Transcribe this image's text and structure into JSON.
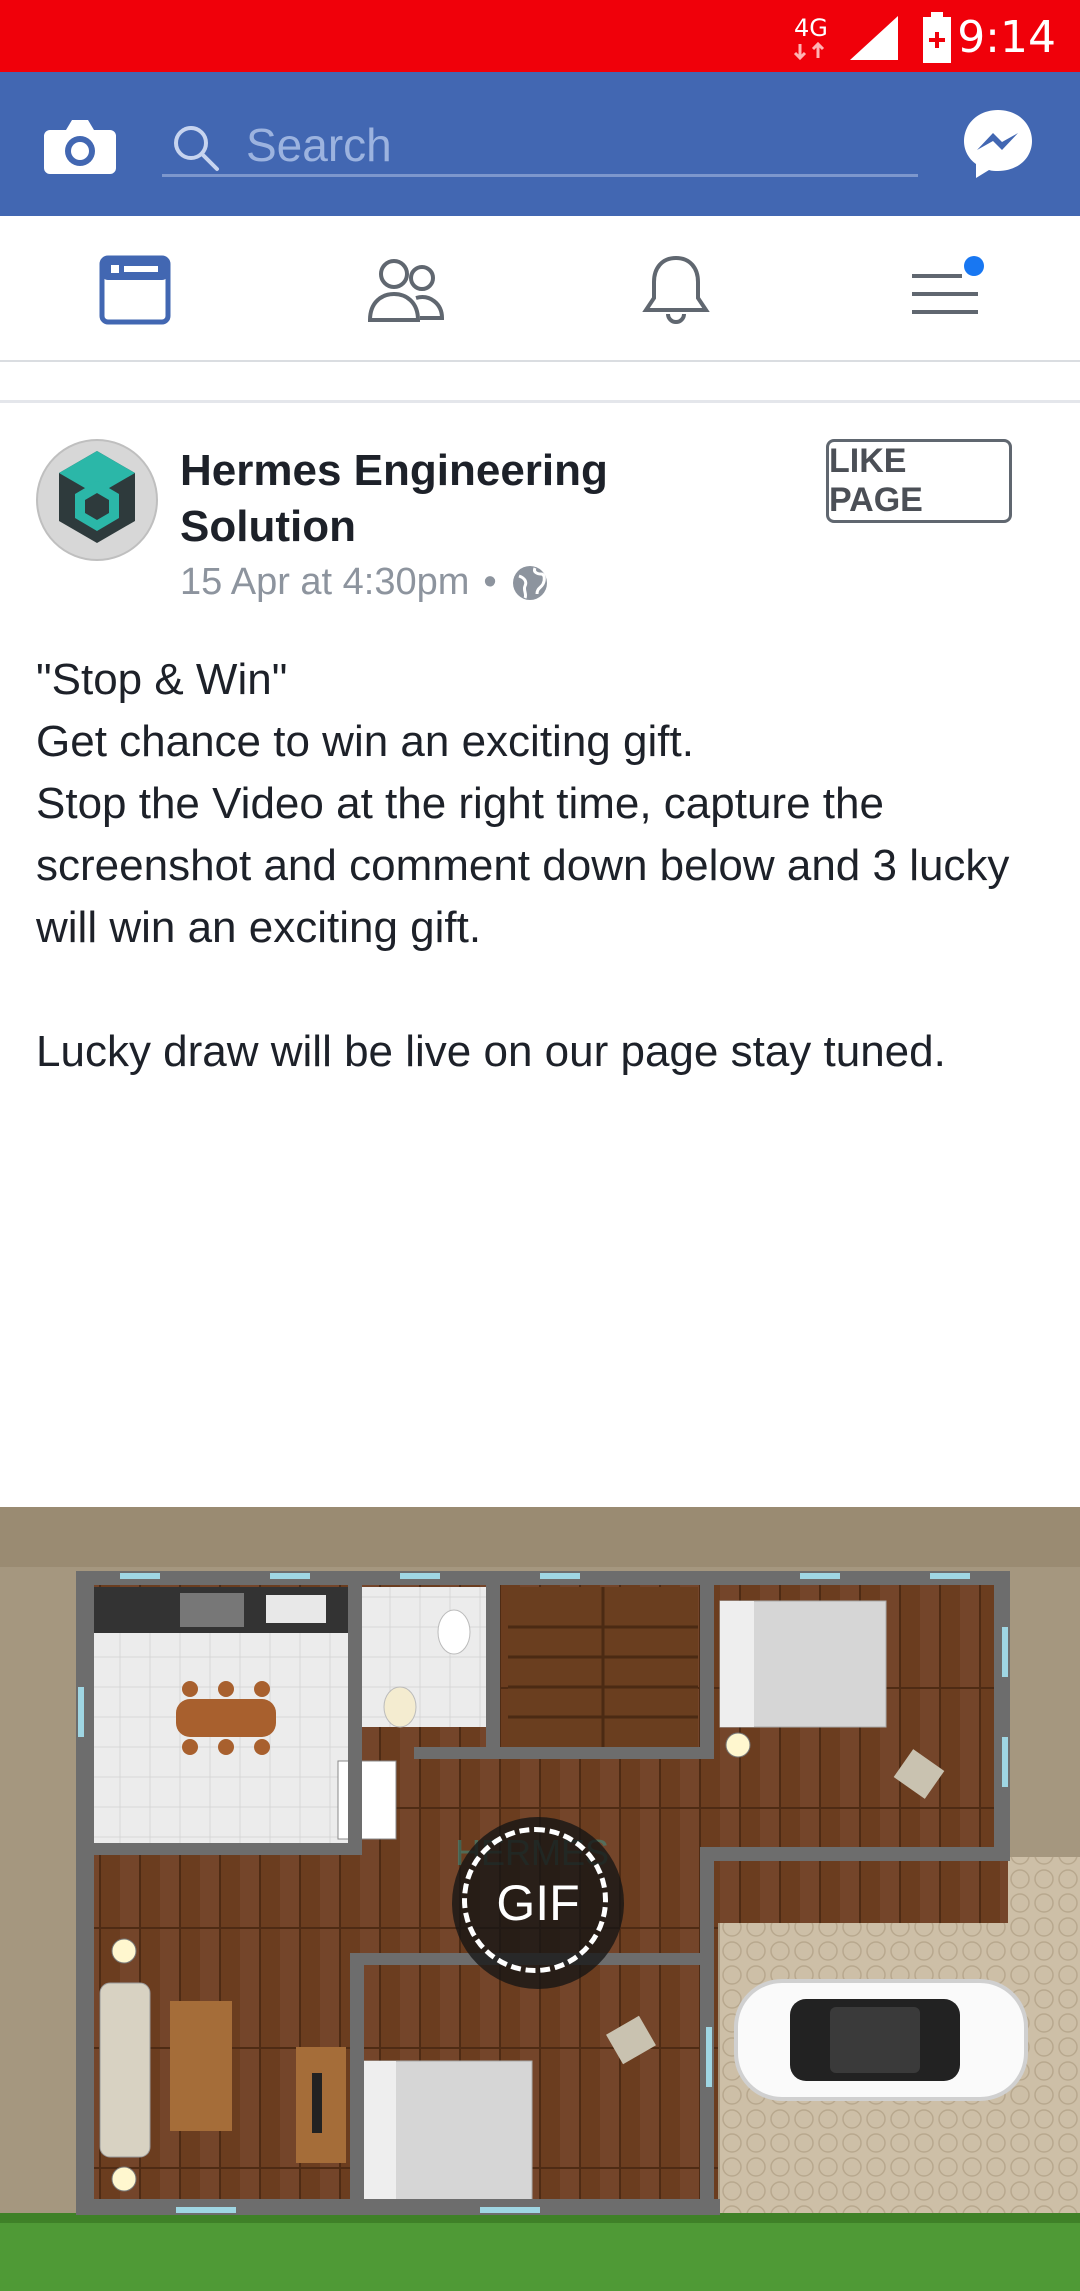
{
  "status_bar": {
    "network": "4G",
    "time": "9:14"
  },
  "top_bar": {
    "search_placeholder": "Search"
  },
  "colors": {
    "status_bar": "#f0000a",
    "brand": "#4267b2",
    "active_tab": "#4267b2",
    "notification_dot": "#1877f2"
  },
  "icons": {
    "camera": "camera-icon",
    "search": "search-icon",
    "messenger": "messenger-icon",
    "news_feed": "news-feed-icon",
    "friends": "friends-icon",
    "notifications": "bell-icon",
    "menu": "menu-icon",
    "globe": "globe-icon"
  },
  "post": {
    "author": "Hermes Engineering Solution",
    "timestamp": "15 Apr at 4:30pm",
    "separator": "•",
    "like_page_label": "LIKE PAGE",
    "lines": [
      "\"Stop & Win\"",
      "Get chance to win an exciting gift.",
      "Stop the Video at the right time, capture the screenshot and comment down below and 3 lucky will win an exciting gift.",
      "Lucky draw will be live on our page stay tuned."
    ],
    "media_badge": "GIF",
    "media_watermark": "HERMES"
  }
}
